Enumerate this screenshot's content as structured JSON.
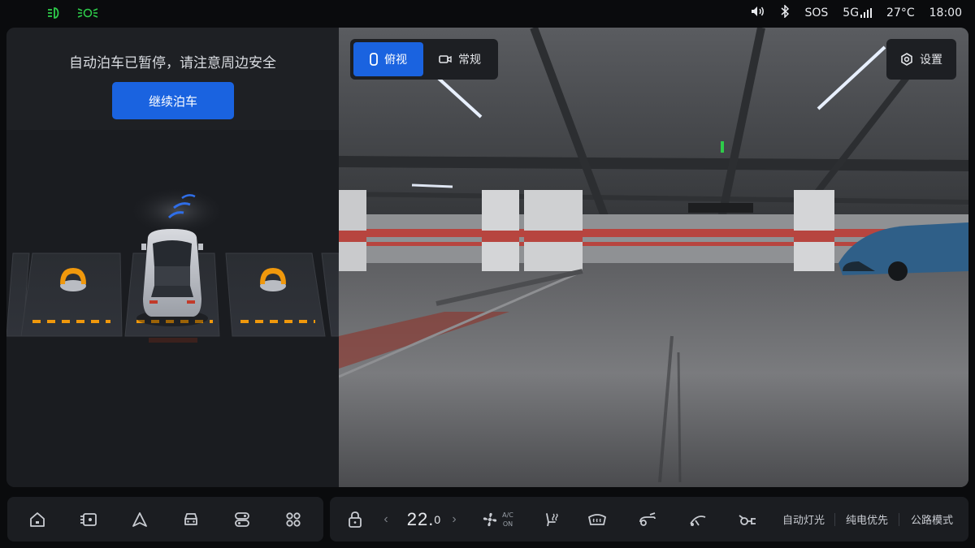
{
  "status_bar": {
    "sos": "SOS",
    "network": "5G",
    "temperature": "27°C",
    "time": "18:00",
    "icons": [
      "low-beam-icon",
      "position-light-icon",
      "volume-icon",
      "bluetooth-icon",
      "signal-icon"
    ]
  },
  "parking": {
    "notice": "自动泊车已暂停，请注意周边安全",
    "continue_label": "继续泊车"
  },
  "camera": {
    "view_top_label": "俯视",
    "view_normal_label": "常规",
    "settings_label": "设置",
    "active_view": "俯视"
  },
  "dock": {
    "left_icons": [
      "home-icon",
      "media-icon",
      "navigation-icon",
      "car-icon",
      "toggle-icon",
      "apps-icon"
    ],
    "climate": {
      "temp_main": "22.",
      "temp_decimal": "0",
      "ac_top": "A/C",
      "ac_bottom": "ON"
    },
    "auto_light": "自动灯光",
    "ev_priority": "纯电优先",
    "road_mode": "公路模式"
  },
  "colors": {
    "accent": "#1a63e0",
    "status_green": "#2ecc4a",
    "lock_orange": "#f0980c"
  }
}
